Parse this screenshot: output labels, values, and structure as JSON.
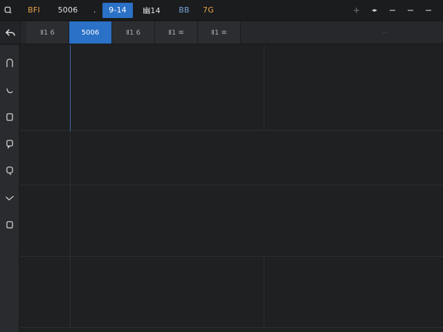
{
  "topbar": {
    "items": [
      {
        "label": "BFI",
        "style": "orange"
      },
      {
        "label": "5006",
        "style": "normal"
      },
      {
        "label": ".",
        "style": "normal"
      },
      {
        "label": "9-14",
        "style": "active"
      },
      {
        "label": "幽14",
        "style": "normal"
      },
      {
        "label": "BB",
        "style": "blue"
      },
      {
        "label": "7G",
        "style": "orange"
      }
    ],
    "window_controls": [
      "add-icon",
      "diamond-icon",
      "minimize-icon",
      "restore-icon",
      "close-icon"
    ]
  },
  "tabs": {
    "items": [
      {
        "label": "Ⅱ1 6"
      },
      {
        "label": "5006"
      },
      {
        "label": "Ⅱ1 6"
      },
      {
        "label": "Ⅱ1 ≡"
      },
      {
        "label": "Ⅱ1 ≡"
      }
    ],
    "active_index": 1
  },
  "sidebar": {
    "icons": [
      "arch-icon",
      "curve-icon",
      "square-icon",
      "note-icon",
      "pin-icon",
      "check-icon",
      "page-icon"
    ]
  },
  "colors": {
    "accent": "#2a71c7",
    "orange": "#e7a44a",
    "background": "#1e1f21"
  }
}
